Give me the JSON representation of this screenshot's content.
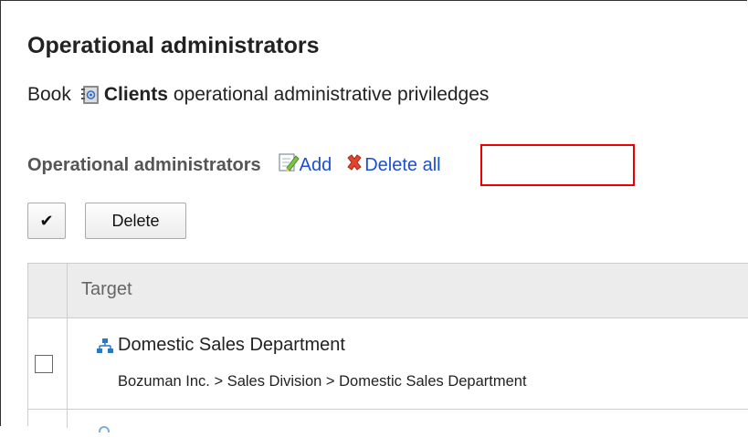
{
  "page": {
    "title": "Operational administrators",
    "book_prefix": "Book",
    "book_name": "Clients",
    "book_suffix": "operational administrative priviledges"
  },
  "section": {
    "title": "Operational administrators",
    "add_label": "Add",
    "delete_all_label": "Delete all"
  },
  "toolbar": {
    "check_all_label": "✔",
    "delete_label": "Delete"
  },
  "table": {
    "column_target": "Target",
    "rows": [
      {
        "name": "Domestic Sales Department",
        "path": "Bozuman Inc. > Sales Division > Domestic Sales Department",
        "icon": "org-chart-icon"
      }
    ]
  },
  "colors": {
    "link": "#1a4fd6",
    "highlight": "#ee0000",
    "header_bg": "#ececec"
  }
}
